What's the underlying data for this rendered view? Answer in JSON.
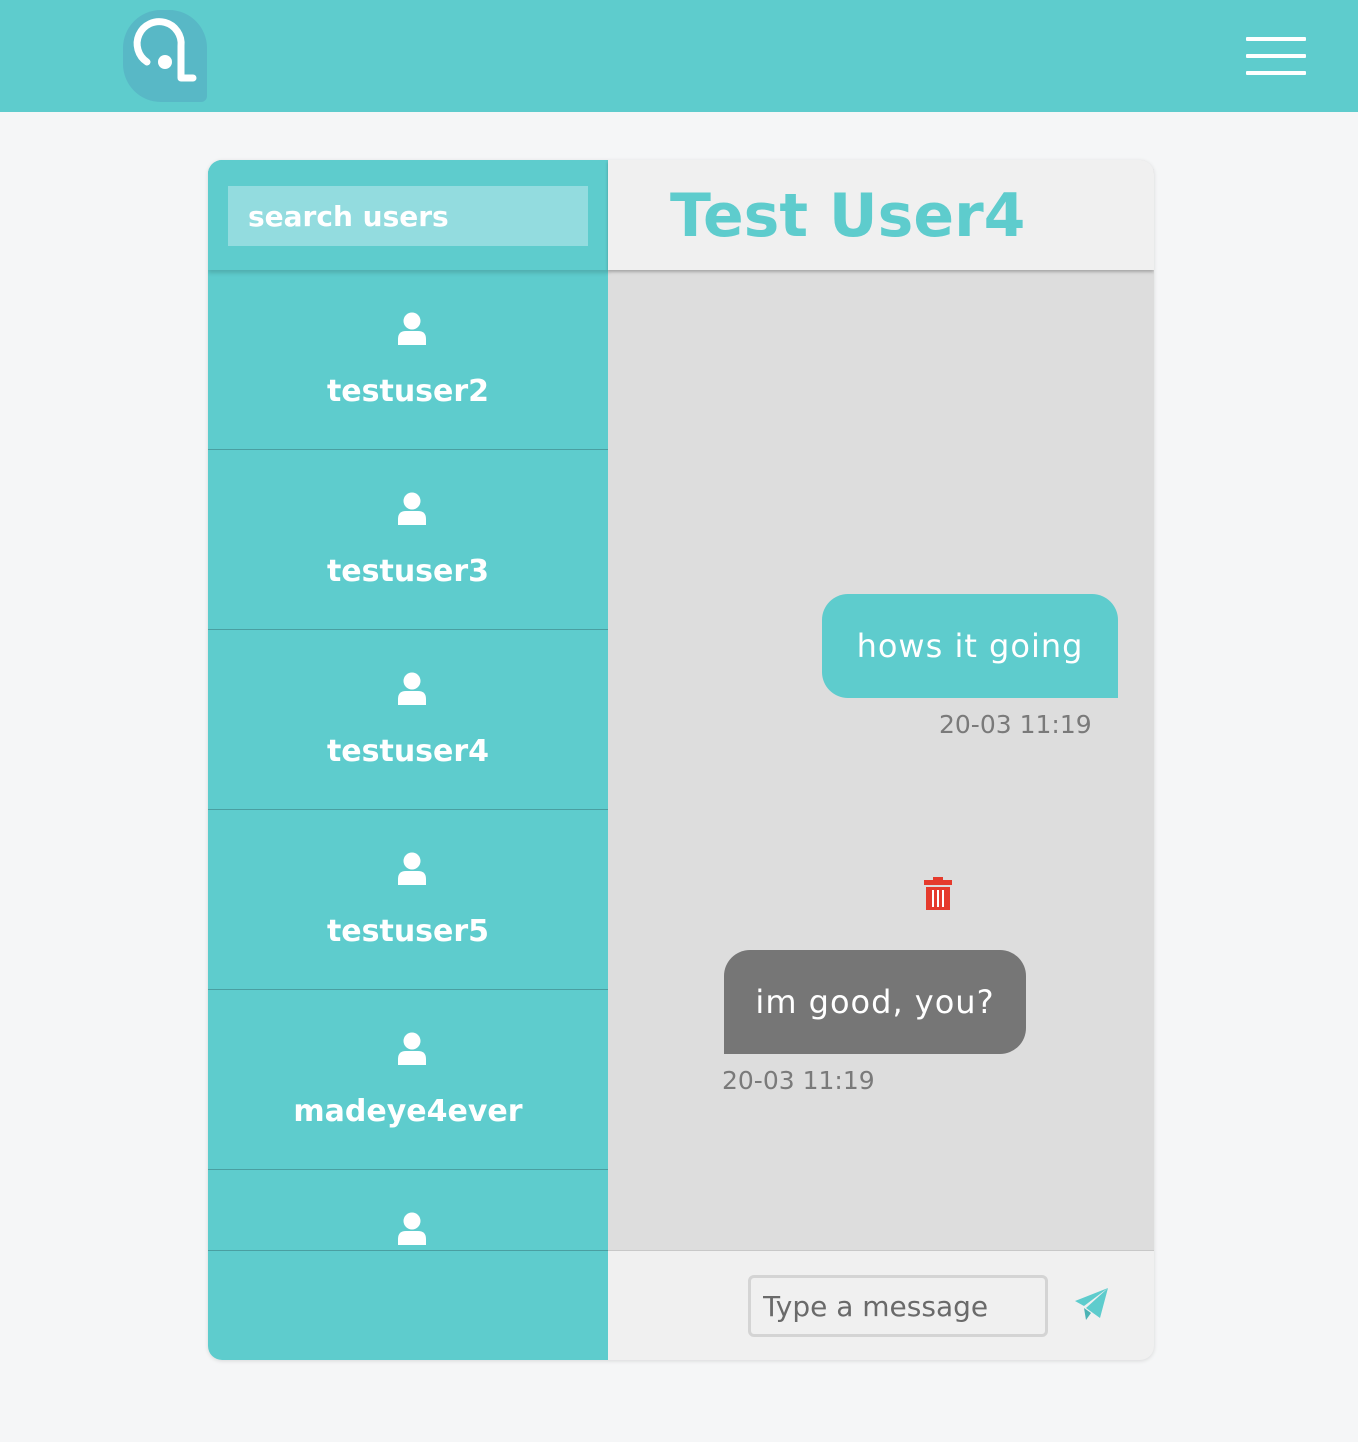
{
  "colors": {
    "brand": "#5ecccd",
    "logo": "#58b8c6",
    "search_field": "#93dcdf",
    "chat_bg": "#dddddd",
    "sent_bubble": "#5ecccd",
    "received_bubble": "#767676",
    "delete": "#e53a2c"
  },
  "header": {
    "logo_icon": "app-logo-icon",
    "menu_icon": "hamburger-menu-icon"
  },
  "sidebar": {
    "search": {
      "placeholder": "search users",
      "value": ""
    },
    "users": [
      {
        "name": "testuser2",
        "icon": "user-icon"
      },
      {
        "name": "testuser3",
        "icon": "user-icon"
      },
      {
        "name": "testuser4",
        "icon": "user-icon"
      },
      {
        "name": "testuser5",
        "icon": "user-icon"
      },
      {
        "name": "madeye4ever",
        "icon": "user-icon"
      },
      {
        "name": "",
        "icon": "user-icon"
      }
    ]
  },
  "chat": {
    "title": "Test User4",
    "messages": [
      {
        "direction": "sent",
        "text": "hows it going",
        "time": "20-03 11:19",
        "delete_icon": "trash-icon"
      },
      {
        "direction": "received",
        "text": "im good, you?",
        "time": "20-03 11:19",
        "delete_icon": "trash-icon"
      }
    ],
    "composer": {
      "placeholder": "Type a message",
      "value": "",
      "send_icon": "paper-plane-icon"
    }
  }
}
